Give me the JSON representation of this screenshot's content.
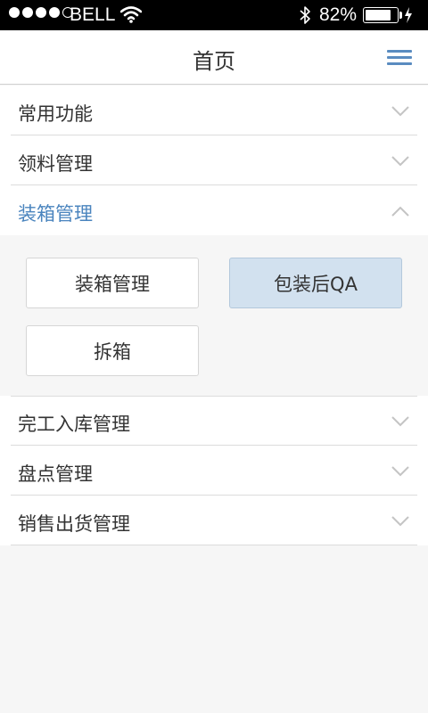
{
  "status_bar": {
    "carrier": "BELL",
    "battery_percent": "82%",
    "battery_level": 0.82,
    "signal_bars": 4,
    "signal_max": 5
  },
  "navbar": {
    "title": "首页",
    "menu_icon": "hamburger-menu-icon",
    "accent_color": "#5a8cc0"
  },
  "menu": {
    "sections": [
      {
        "label": "常用功能",
        "expanded": false
      },
      {
        "label": "领料管理",
        "expanded": false
      },
      {
        "label": "装箱管理",
        "expanded": true,
        "items": [
          {
            "label": "装箱管理",
            "selected": false
          },
          {
            "label": "包装后QA",
            "selected": true
          },
          {
            "label": "拆箱",
            "selected": false
          }
        ]
      },
      {
        "label": "完工入库管理",
        "expanded": false
      },
      {
        "label": "盘点管理",
        "expanded": false
      },
      {
        "label": "销售出货管理",
        "expanded": false
      }
    ]
  },
  "colors": {
    "active_text": "#4a84be",
    "selected_tile_bg": "#d2e1ef",
    "background": "#f6f6f6"
  }
}
